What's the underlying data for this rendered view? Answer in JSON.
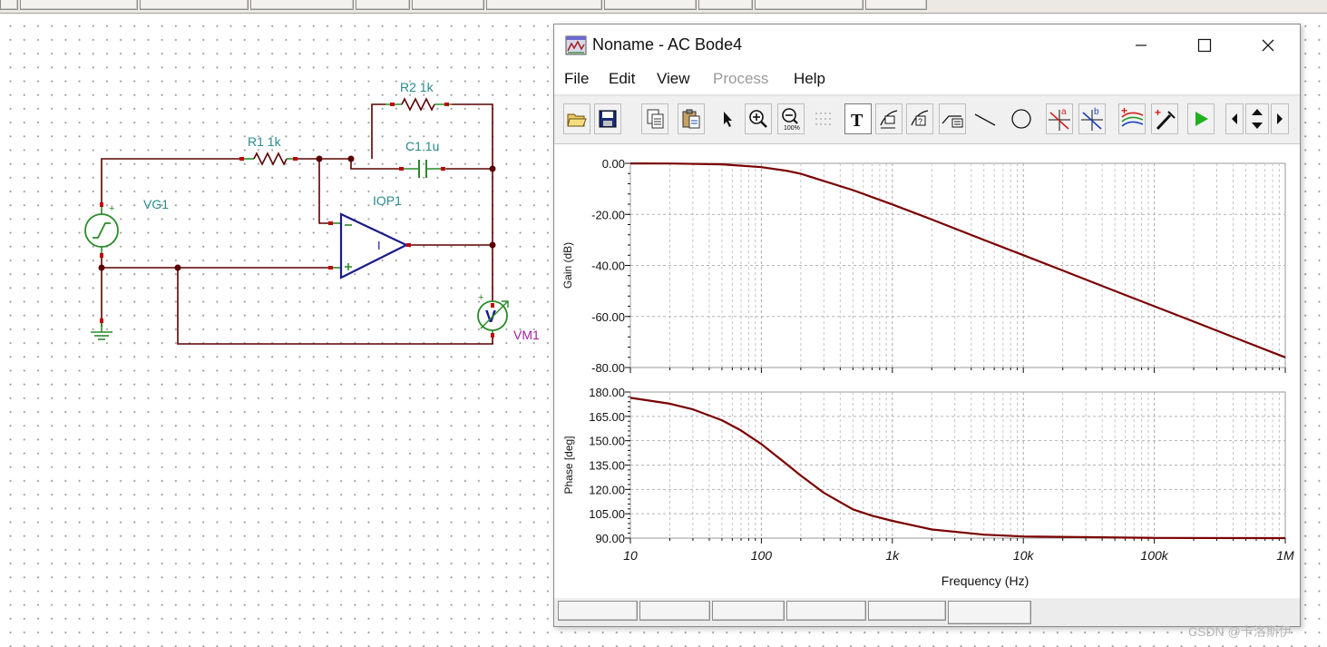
{
  "window": {
    "title": "Noname - AC Bode4",
    "buttons": [
      "minimize",
      "maximize",
      "close"
    ]
  },
  "menu": [
    "File",
    "Edit",
    "View",
    "Process",
    "Help"
  ],
  "menu_disabled": [
    "Process"
  ],
  "toolbar": {
    "icons": [
      "open-icon",
      "save-icon",
      "copy-icon",
      "paste-icon",
      "pointer-icon",
      "zoom-in-icon",
      "zoom-100-icon",
      "grid-icon",
      "text-icon",
      "label-icon",
      "label-help-icon",
      "label-curve-icon",
      "line-icon",
      "circle-icon",
      "cursor-a-icon",
      "cursor-b-icon",
      "add-curve-icon",
      "add-marker-icon",
      "run-icon",
      "scroll-left-icon",
      "scroll-updown-icon",
      "scroll-right-icon"
    ]
  },
  "schematic": {
    "labels": {
      "r2": "R2 1k",
      "r1": "R1 1k",
      "c1": "C1 1u",
      "vg1": "VG1",
      "iop1": "IOP1",
      "vm1": "VM1",
      "vm_symbol": "V",
      "opamp_symbol": "I"
    }
  },
  "chart_data": [
    {
      "type": "line",
      "ylabel": "Gain (dB)",
      "x_scale": "log",
      "xlim": [
        10,
        1000000
      ],
      "ylim": [
        -80,
        0
      ],
      "y_ticks": [
        "0.00",
        "-20.00",
        "-40.00",
        "-60.00",
        "-80.00"
      ],
      "grid": true,
      "series": [
        {
          "color": "#7a0000",
          "x": [
            10,
            20,
            50,
            100,
            159,
            200,
            500,
            1000,
            2000,
            5000,
            10000,
            20000,
            50000,
            100000,
            200000,
            500000,
            1000000
          ],
          "y": [
            -0.02,
            -0.07,
            -0.4,
            -1.5,
            -3.0,
            -4.1,
            -10.5,
            -16.1,
            -22.0,
            -30.0,
            -36.0,
            -42.0,
            -50.0,
            -56.0,
            -62.0,
            -70.0,
            -76.0
          ]
        }
      ]
    },
    {
      "type": "line",
      "xlabel": "Frequency (Hz)",
      "ylabel": "Phase [deg]",
      "x_scale": "log",
      "xlim": [
        10,
        1000000
      ],
      "ylim": [
        90,
        180
      ],
      "y_ticks": [
        "180.00",
        "165.00",
        "150.00",
        "135.00",
        "120.00",
        "105.00",
        "90.00"
      ],
      "x_ticks": [
        "10",
        "100",
        "1k",
        "10k",
        "100k",
        "1M"
      ],
      "grid": true,
      "series": [
        {
          "color": "#7a0000",
          "x": [
            10,
            20,
            30,
            50,
            70,
            100,
            150,
            200,
            300,
            500,
            700,
            1000,
            2000,
            5000,
            10000,
            100000,
            1000000
          ],
          "y": [
            176.4,
            172.8,
            169.3,
            162.6,
            156.3,
            147.9,
            136.7,
            128.5,
            117.9,
            107.7,
            103.8,
            100.6,
            95.3,
            92.1,
            91.0,
            90.1,
            90.0
          ]
        }
      ]
    }
  ],
  "watermark": "CSDN @卡洛斯伊"
}
